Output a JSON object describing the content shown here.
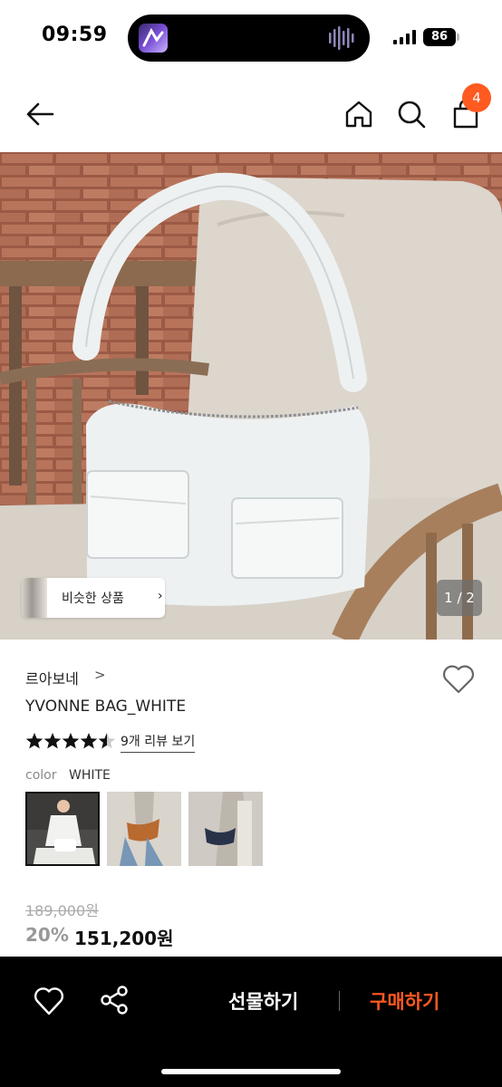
{
  "status_bar": {
    "time": "09:59",
    "battery": "86"
  },
  "header": {
    "cart_count": "4"
  },
  "hero": {
    "similar_label": "비슷한 상품",
    "chevron": "›",
    "pager": "1 / 2"
  },
  "product": {
    "brand": "르아보네",
    "brand_chevron": ">",
    "name": "YVONNE BAG_WHITE",
    "rating": 4.5,
    "review_link": "9개 리뷰 보기",
    "color_label": "color",
    "color_value": "WHITE",
    "original_price": "189,000원",
    "discount": "20%",
    "price": "151,200원"
  },
  "bottom_bar": {
    "gift_label": "선물하기",
    "buy_label": "구매하기"
  },
  "colors": {
    "accent": "#ff5a1f",
    "bar": "#000000"
  },
  "icons": [
    "arrow-left-icon",
    "home-icon",
    "search-icon",
    "shopping-bag-icon",
    "heart-icon",
    "star-icon",
    "share-icon",
    "chevron-right-icon"
  ]
}
